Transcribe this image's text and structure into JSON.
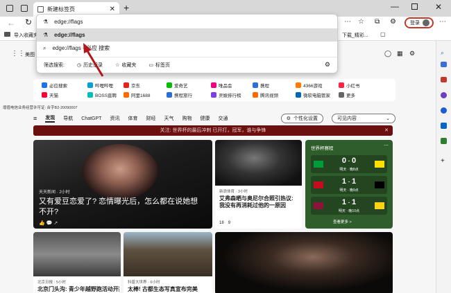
{
  "tab": {
    "title": "新建标签页"
  },
  "address": {
    "value": "edge://flags"
  },
  "toolbar": {
    "login_label": "登录"
  },
  "favorites": {
    "import_label": "导入收藏夹",
    "right_label": "下载_精彩..."
  },
  "suggestions": [
    {
      "text": "edge://flags"
    },
    {
      "text": "edge://flags - 必应 搜索"
    }
  ],
  "dropdown_footer": {
    "filter_label": "筛选搜索:",
    "history": "历史记录",
    "favorites": "收藏夹",
    "tabs": "标签页"
  },
  "page_header": {
    "partial_label": "美图",
    "icp": "增值电信业务经营许可证: 合字B2-20090007"
  },
  "quick_links": [
    {
      "label": "必应搜索",
      "color": "#1a73e8"
    },
    {
      "label": "哔哩哔哩",
      "color": "#00a1d6"
    },
    {
      "label": "京东",
      "color": "#e1251b"
    },
    {
      "label": "爱奇艺",
      "color": "#00be06"
    },
    {
      "label": "唯品会",
      "color": "#f10180"
    },
    {
      "label": "携程",
      "color": "#2b6fd6"
    },
    {
      "label": "4366游戏",
      "color": "#ff7a00"
    },
    {
      "label": "小红书",
      "color": "#ff2442"
    },
    {
      "label": "天猫",
      "color": "#ff0036"
    },
    {
      "label": "BOSS直聘",
      "color": "#00bebd"
    },
    {
      "label": "阿里1688",
      "color": "#ff6a00"
    },
    {
      "label": "携程旅行",
      "color": "#2b6fd6"
    },
    {
      "label": "灵娱排行榜",
      "color": "#7b3fe4"
    },
    {
      "label": "腾讯视频",
      "color": "#ff6a00"
    },
    {
      "label": "微软电脑管家",
      "color": "#0067b8"
    },
    {
      "label": "更多",
      "color": "#666666"
    }
  ],
  "nav": {
    "items": [
      "发现",
      "导航",
      "ChatGPT",
      "资讯",
      "体育",
      "财经",
      "天气",
      "购物",
      "健康",
      "交通"
    ],
    "personalize": "个性化设置",
    "usable": "可见内容"
  },
  "banner": {
    "text": "关注: 世界杯的最后冲刺 已开打，冠军，谁与争锋"
  },
  "cards": {
    "main": {
      "source": "天天新闻 · 2小时",
      "title": "又有爱豆恋爱了? 恋情曝光后，怎么都在说她想不开?"
    },
    "side": {
      "source": "新浪体育 · 3小时",
      "title": "艾弗森晒与奥尼尔合照引热议: 我没有再消耗过他的一原因",
      "likes": "18",
      "comments": "9"
    },
    "bottom1": {
      "source": "北京日报 · 5小时",
      "title": "北京门头沟: 青少年越野跑活动开跑"
    },
    "bottom2": {
      "source": "科普大世界 · 6小时",
      "title": "太棒! 古都生态写真宣布完美"
    }
  },
  "scores": {
    "title": "世界杯赛程",
    "matches": [
      {
        "a": "0",
        "b": "0",
        "time": "明天 · 晚8点"
      },
      {
        "a": "1",
        "b": "1",
        "time": "明天 · 晚9点"
      },
      {
        "a": "1",
        "b": "1",
        "time": "明天 · 晚10点"
      }
    ],
    "more": "查看更多 >"
  }
}
